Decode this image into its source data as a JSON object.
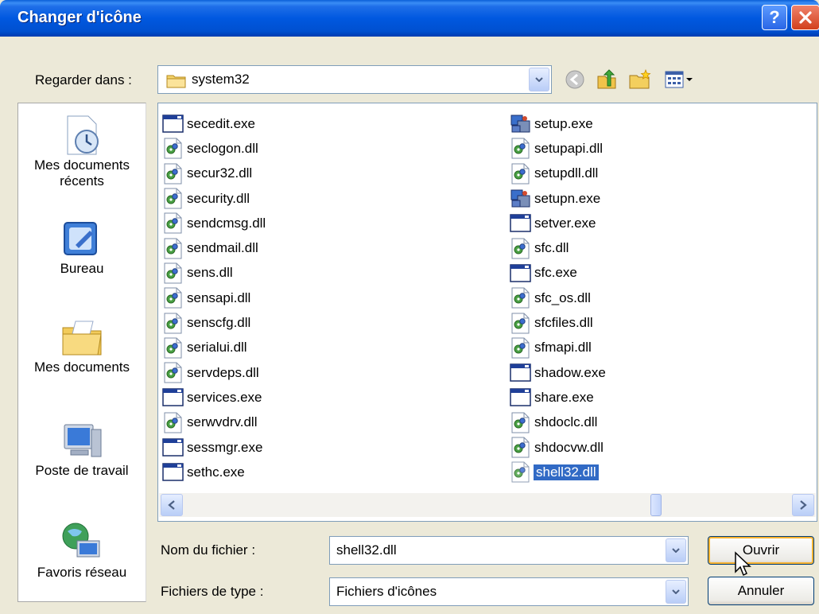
{
  "window": {
    "title": "Changer d'icône"
  },
  "lookin": {
    "label": "Regarder dans :",
    "value": "system32"
  },
  "places": [
    {
      "label_lines": [
        "Mes documents",
        "récents"
      ],
      "icon": "recent-documents-icon"
    },
    {
      "label_lines": [
        "Bureau"
      ],
      "icon": "desktop-icon"
    },
    {
      "label_lines": [
        "Mes documents"
      ],
      "icon": "my-documents-icon"
    },
    {
      "label_lines": [
        "Poste de travail"
      ],
      "icon": "my-computer-icon"
    },
    {
      "label_lines": [
        "Favoris réseau"
      ],
      "icon": "network-places-icon"
    }
  ],
  "files": {
    "col1": [
      {
        "name": "secedit.exe",
        "type": "exe"
      },
      {
        "name": "seclogon.dll",
        "type": "dll"
      },
      {
        "name": "secur32.dll",
        "type": "dll"
      },
      {
        "name": "security.dll",
        "type": "dll"
      },
      {
        "name": "sendcmsg.dll",
        "type": "dll"
      },
      {
        "name": "sendmail.dll",
        "type": "dll"
      },
      {
        "name": "sens.dll",
        "type": "dll"
      },
      {
        "name": "sensapi.dll",
        "type": "dll"
      },
      {
        "name": "senscfg.dll",
        "type": "dll"
      },
      {
        "name": "serialui.dll",
        "type": "dll"
      },
      {
        "name": "servdeps.dll",
        "type": "dll"
      },
      {
        "name": "services.exe",
        "type": "exe"
      },
      {
        "name": "serwvdrv.dll",
        "type": "dll"
      },
      {
        "name": "sessmgr.exe",
        "type": "exe"
      },
      {
        "name": "sethc.exe",
        "type": "exe"
      }
    ],
    "col2": [
      {
        "name": "setup.exe",
        "type": "setup"
      },
      {
        "name": "setupapi.dll",
        "type": "dll"
      },
      {
        "name": "setupdll.dll",
        "type": "dll"
      },
      {
        "name": "setupn.exe",
        "type": "setup"
      },
      {
        "name": "setver.exe",
        "type": "exe"
      },
      {
        "name": "sfc.dll",
        "type": "dll"
      },
      {
        "name": "sfc.exe",
        "type": "exe"
      },
      {
        "name": "sfc_os.dll",
        "type": "dll"
      },
      {
        "name": "sfcfiles.dll",
        "type": "dll"
      },
      {
        "name": "sfmapi.dll",
        "type": "dll"
      },
      {
        "name": "shadow.exe",
        "type": "exe"
      },
      {
        "name": "share.exe",
        "type": "exe"
      },
      {
        "name": "shdoclc.dll",
        "type": "dll"
      },
      {
        "name": "shdocvw.dll",
        "type": "dll"
      },
      {
        "name": "shell32.dll",
        "type": "dll",
        "selected": true
      }
    ]
  },
  "filename": {
    "label": "Nom du fichier :",
    "value": "shell32.dll"
  },
  "filetype": {
    "label": "Fichiers de type :",
    "value": "Fichiers d'icônes"
  },
  "buttons": {
    "open": "Ouvrir",
    "cancel": "Annuler"
  },
  "colors": {
    "selection": "#316ac5",
    "titlebar": "#0058e0",
    "face": "#ece9d8"
  }
}
